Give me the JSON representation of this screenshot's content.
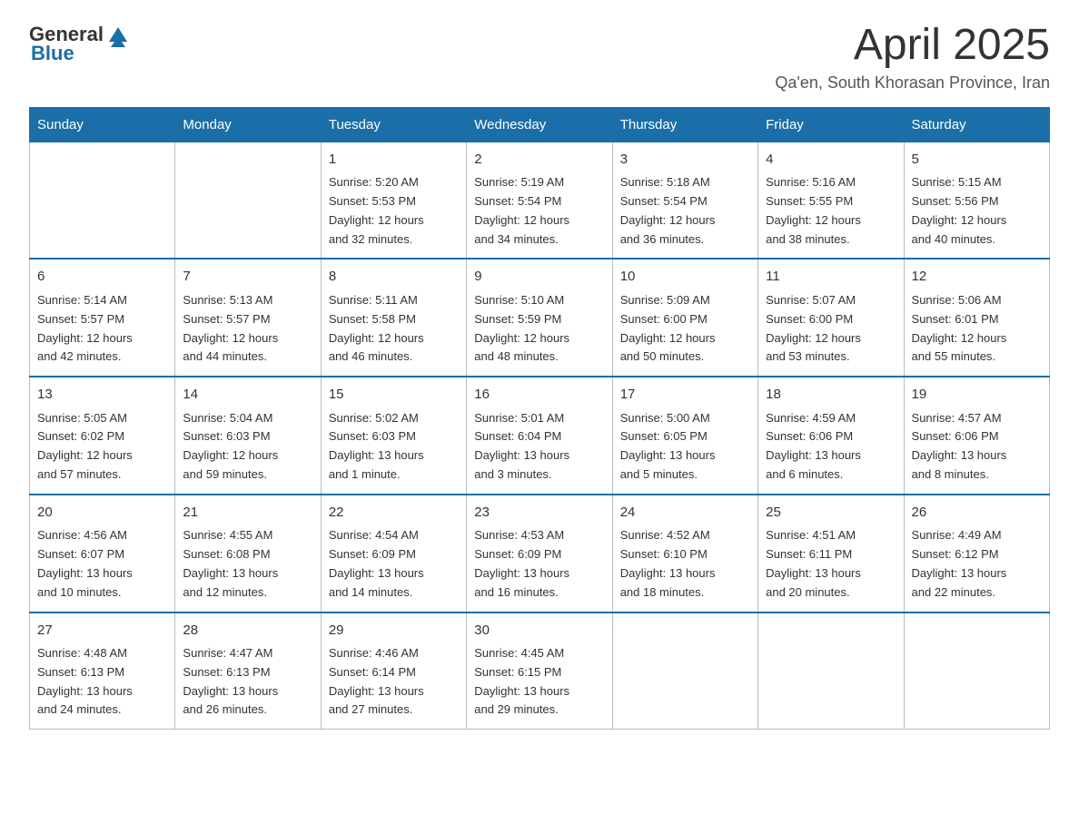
{
  "header": {
    "logo_general": "General",
    "logo_blue": "Blue",
    "title": "April 2025",
    "subtitle": "Qa'en, South Khorasan Province, Iran"
  },
  "days_of_week": [
    "Sunday",
    "Monday",
    "Tuesday",
    "Wednesday",
    "Thursday",
    "Friday",
    "Saturday"
  ],
  "weeks": [
    [
      {
        "day": "",
        "info": ""
      },
      {
        "day": "",
        "info": ""
      },
      {
        "day": "1",
        "info": "Sunrise: 5:20 AM\nSunset: 5:53 PM\nDaylight: 12 hours\nand 32 minutes."
      },
      {
        "day": "2",
        "info": "Sunrise: 5:19 AM\nSunset: 5:54 PM\nDaylight: 12 hours\nand 34 minutes."
      },
      {
        "day": "3",
        "info": "Sunrise: 5:18 AM\nSunset: 5:54 PM\nDaylight: 12 hours\nand 36 minutes."
      },
      {
        "day": "4",
        "info": "Sunrise: 5:16 AM\nSunset: 5:55 PM\nDaylight: 12 hours\nand 38 minutes."
      },
      {
        "day": "5",
        "info": "Sunrise: 5:15 AM\nSunset: 5:56 PM\nDaylight: 12 hours\nand 40 minutes."
      }
    ],
    [
      {
        "day": "6",
        "info": "Sunrise: 5:14 AM\nSunset: 5:57 PM\nDaylight: 12 hours\nand 42 minutes."
      },
      {
        "day": "7",
        "info": "Sunrise: 5:13 AM\nSunset: 5:57 PM\nDaylight: 12 hours\nand 44 minutes."
      },
      {
        "day": "8",
        "info": "Sunrise: 5:11 AM\nSunset: 5:58 PM\nDaylight: 12 hours\nand 46 minutes."
      },
      {
        "day": "9",
        "info": "Sunrise: 5:10 AM\nSunset: 5:59 PM\nDaylight: 12 hours\nand 48 minutes."
      },
      {
        "day": "10",
        "info": "Sunrise: 5:09 AM\nSunset: 6:00 PM\nDaylight: 12 hours\nand 50 minutes."
      },
      {
        "day": "11",
        "info": "Sunrise: 5:07 AM\nSunset: 6:00 PM\nDaylight: 12 hours\nand 53 minutes."
      },
      {
        "day": "12",
        "info": "Sunrise: 5:06 AM\nSunset: 6:01 PM\nDaylight: 12 hours\nand 55 minutes."
      }
    ],
    [
      {
        "day": "13",
        "info": "Sunrise: 5:05 AM\nSunset: 6:02 PM\nDaylight: 12 hours\nand 57 minutes."
      },
      {
        "day": "14",
        "info": "Sunrise: 5:04 AM\nSunset: 6:03 PM\nDaylight: 12 hours\nand 59 minutes."
      },
      {
        "day": "15",
        "info": "Sunrise: 5:02 AM\nSunset: 6:03 PM\nDaylight: 13 hours\nand 1 minute."
      },
      {
        "day": "16",
        "info": "Sunrise: 5:01 AM\nSunset: 6:04 PM\nDaylight: 13 hours\nand 3 minutes."
      },
      {
        "day": "17",
        "info": "Sunrise: 5:00 AM\nSunset: 6:05 PM\nDaylight: 13 hours\nand 5 minutes."
      },
      {
        "day": "18",
        "info": "Sunrise: 4:59 AM\nSunset: 6:06 PM\nDaylight: 13 hours\nand 6 minutes."
      },
      {
        "day": "19",
        "info": "Sunrise: 4:57 AM\nSunset: 6:06 PM\nDaylight: 13 hours\nand 8 minutes."
      }
    ],
    [
      {
        "day": "20",
        "info": "Sunrise: 4:56 AM\nSunset: 6:07 PM\nDaylight: 13 hours\nand 10 minutes."
      },
      {
        "day": "21",
        "info": "Sunrise: 4:55 AM\nSunset: 6:08 PM\nDaylight: 13 hours\nand 12 minutes."
      },
      {
        "day": "22",
        "info": "Sunrise: 4:54 AM\nSunset: 6:09 PM\nDaylight: 13 hours\nand 14 minutes."
      },
      {
        "day": "23",
        "info": "Sunrise: 4:53 AM\nSunset: 6:09 PM\nDaylight: 13 hours\nand 16 minutes."
      },
      {
        "day": "24",
        "info": "Sunrise: 4:52 AM\nSunset: 6:10 PM\nDaylight: 13 hours\nand 18 minutes."
      },
      {
        "day": "25",
        "info": "Sunrise: 4:51 AM\nSunset: 6:11 PM\nDaylight: 13 hours\nand 20 minutes."
      },
      {
        "day": "26",
        "info": "Sunrise: 4:49 AM\nSunset: 6:12 PM\nDaylight: 13 hours\nand 22 minutes."
      }
    ],
    [
      {
        "day": "27",
        "info": "Sunrise: 4:48 AM\nSunset: 6:13 PM\nDaylight: 13 hours\nand 24 minutes."
      },
      {
        "day": "28",
        "info": "Sunrise: 4:47 AM\nSunset: 6:13 PM\nDaylight: 13 hours\nand 26 minutes."
      },
      {
        "day": "29",
        "info": "Sunrise: 4:46 AM\nSunset: 6:14 PM\nDaylight: 13 hours\nand 27 minutes."
      },
      {
        "day": "30",
        "info": "Sunrise: 4:45 AM\nSunset: 6:15 PM\nDaylight: 13 hours\nand 29 minutes."
      },
      {
        "day": "",
        "info": ""
      },
      {
        "day": "",
        "info": ""
      },
      {
        "day": "",
        "info": ""
      }
    ]
  ]
}
